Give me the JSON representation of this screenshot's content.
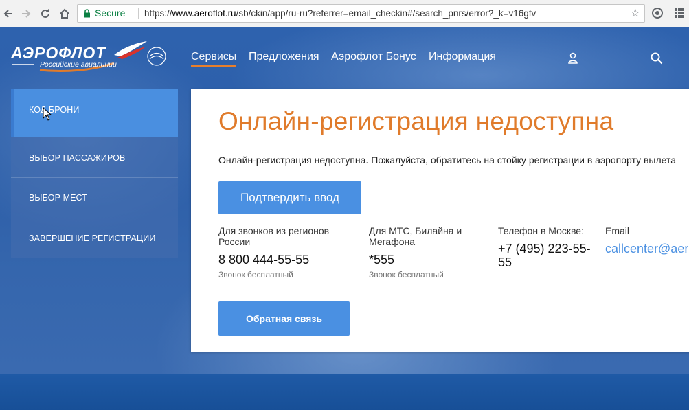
{
  "browser": {
    "secure_label": "Secure",
    "url_scheme": "https://",
    "url_host": "www.aeroflot.ru",
    "url_path": "/sb/ckin/app/ru-ru?referrer=email_checkin#/search_pnrs/error?_k=v16gfv"
  },
  "logo": {
    "name": "АЭРОФЛОТ",
    "tagline": "Российские авиалинии"
  },
  "nav": {
    "items": [
      {
        "label": "Сервисы"
      },
      {
        "label": "Предложения"
      },
      {
        "label": "Аэрофлот Бонус"
      },
      {
        "label": "Информация"
      }
    ]
  },
  "steps": [
    {
      "label": "Код брони",
      "active": true
    },
    {
      "label": "Выбор пассажиров"
    },
    {
      "label": "Выбор мест"
    },
    {
      "label": "Завершение регистрации"
    }
  ],
  "card": {
    "title": "Онлайн-регистрация недоступна",
    "message": "Онлайн-регистрация недоступна. Пожалуйста, обратитесь на стойку регистрации в аэропорту вылета",
    "confirm_button": "Подтвердить ввод",
    "feedback_button": "Обратная связь",
    "contacts": [
      {
        "label": "Для звонков из регионов России",
        "value": "8 800 444-55-55",
        "note": "Звонок бесплатный"
      },
      {
        "label": "Для МТС, Билайна и Мегафона",
        "value": "*555",
        "note": "Звонок бесплатный"
      },
      {
        "label": "Телефон в Москве:",
        "value": "+7 (495) 223-55-55"
      },
      {
        "label": "Email",
        "value": "callcenter@aer"
      }
    ]
  },
  "colors": {
    "accent_orange": "#e07b2b",
    "button_blue": "#4a90e2",
    "secure_green": "#0b8043"
  }
}
